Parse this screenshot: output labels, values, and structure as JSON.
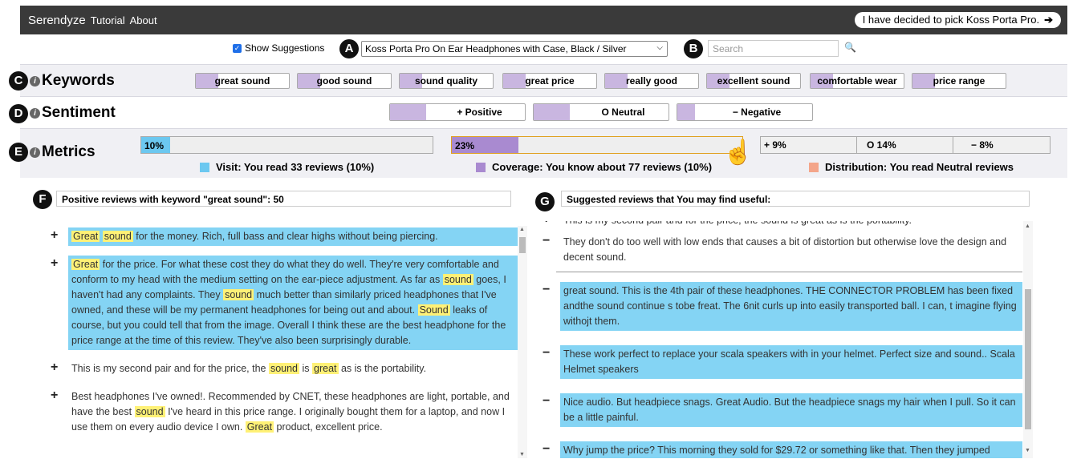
{
  "app": {
    "brand": "Serendyze",
    "tutorial": "Tutorial",
    "about": "About",
    "picked": "I have decided to pick Koss Porta Pro.",
    "picked_arrow": "➔"
  },
  "controls": {
    "show_suggestions": "Show Suggestions",
    "product": "Koss Porta Pro On Ear Headphones with Case, Black / Silver",
    "search_placeholder": "Search"
  },
  "markers": {
    "a": "A",
    "b": "B",
    "c": "C",
    "d": "D",
    "e": "E",
    "f": "F",
    "g": "G"
  },
  "keywords": {
    "title": "Keywords",
    "items": [
      {
        "pre": "",
        "post": "great sound"
      },
      {
        "pre": "",
        "post": "good sound"
      },
      {
        "pre": "",
        "post": "sound quality"
      },
      {
        "pre": "",
        "post": "great price"
      },
      {
        "pre": "",
        "post": "really good"
      },
      {
        "pre": "",
        "post": "excellent sound"
      },
      {
        "pre": "",
        "post": "comfortable wear"
      },
      {
        "pre": "",
        "post": "price range"
      }
    ]
  },
  "sentiment": {
    "title": "Sentiment",
    "positive": "+ Positive",
    "neutral": "O Neutral",
    "negative": "− Negative"
  },
  "metrics": {
    "title": "Metrics",
    "visit": {
      "value": "10%",
      "fill": 0.1,
      "legend": "Visit: You read 33 reviews (10%)",
      "color": "#6cc8f0"
    },
    "coverage": {
      "value": "23%",
      "fill": 0.23,
      "legend": "Coverage: You know about 77  reviews (10%)",
      "color": "#a98ad0"
    },
    "distribution": {
      "pos": "+ 9%",
      "neu": "O 14%",
      "neg": "− 8%",
      "legend": "Distribution: You read Neutral reviews",
      "color": "#f4a58a"
    }
  },
  "left": {
    "header": "Positive reviews with keyword \"great sound\": 50",
    "reviews": [
      {
        "sign": "+",
        "html": "<span class='hl'>Great</span> <span class='hl'>sound</span> for the money. Rich, full bass and clear highs without being piercing.",
        "blue": true
      },
      {
        "sign": "+",
        "html": "<span class='hl'>Great</span> for the price. For what these cost they do what they do well. They're very comfortable and conform to my head with the medium setting on the ear-piece adjustment. As far as <span class='hl'>sound</span> goes, I haven't had any complaints. They <span class='hl'>sound</span> much better than similarly priced headphones that I've owned, and these will be my permanent headphones for being out and about. <span class='hl'>Sound</span> leaks of course, but you could tell that from the image. Overall I think these are the best headphone for the price range at the time of this review. They've also been surprisingly durable.",
        "blue": true
      },
      {
        "sign": "+",
        "html": "This is my second pair and for the price, the <span class='hl'>sound</span> is <span class='hl'>great</span> as is the portability.",
        "blue": false
      },
      {
        "sign": "+",
        "html": "Best headphones I've owned!. Recommended by CNET, these headphones are light, portable, and have the best <span class='hl'>sound</span> I've heard in this price range. I originally bought them for a laptop, and now I use them on every audio device I own. <span class='hl'>Great</span> product, excellent price.",
        "blue": false
      }
    ]
  },
  "right": {
    "header": "Suggested reviews that You may find useful:",
    "top_cut": "This is my second pair and for the price, the sound is great as is the portability.",
    "reviews": [
      {
        "sign": "−",
        "text": "They don't do too well with low ends that causes a bit of distortion but otherwise love the design and decent sound.",
        "blue": false
      },
      {
        "sign": "−",
        "text": "great sound. This is the 4th pair of these headphones. THE CONNECTOR PROBLEM has been fixed andthe sound continue s tobe freat. The 6nit curls up into easily transported ball. I can, t imagine flying withojt them.",
        "blue": true
      },
      {
        "sign": "−",
        "text": "These work perfect to replace your scala speakers with in your helmet. Perfect size and sound.. Scala Helmet speakers",
        "blue": true
      },
      {
        "sign": "−",
        "text": "Nice audio. But headpiece snags. Great Audio. But the headpiece snags my hair when I pull. So it can be a little painful.",
        "blue": true
      },
      {
        "sign": "−",
        "text": "Why jump the price? This morning they sold for $29.72 or something like that. Then they jumped",
        "blue": true
      }
    ]
  }
}
